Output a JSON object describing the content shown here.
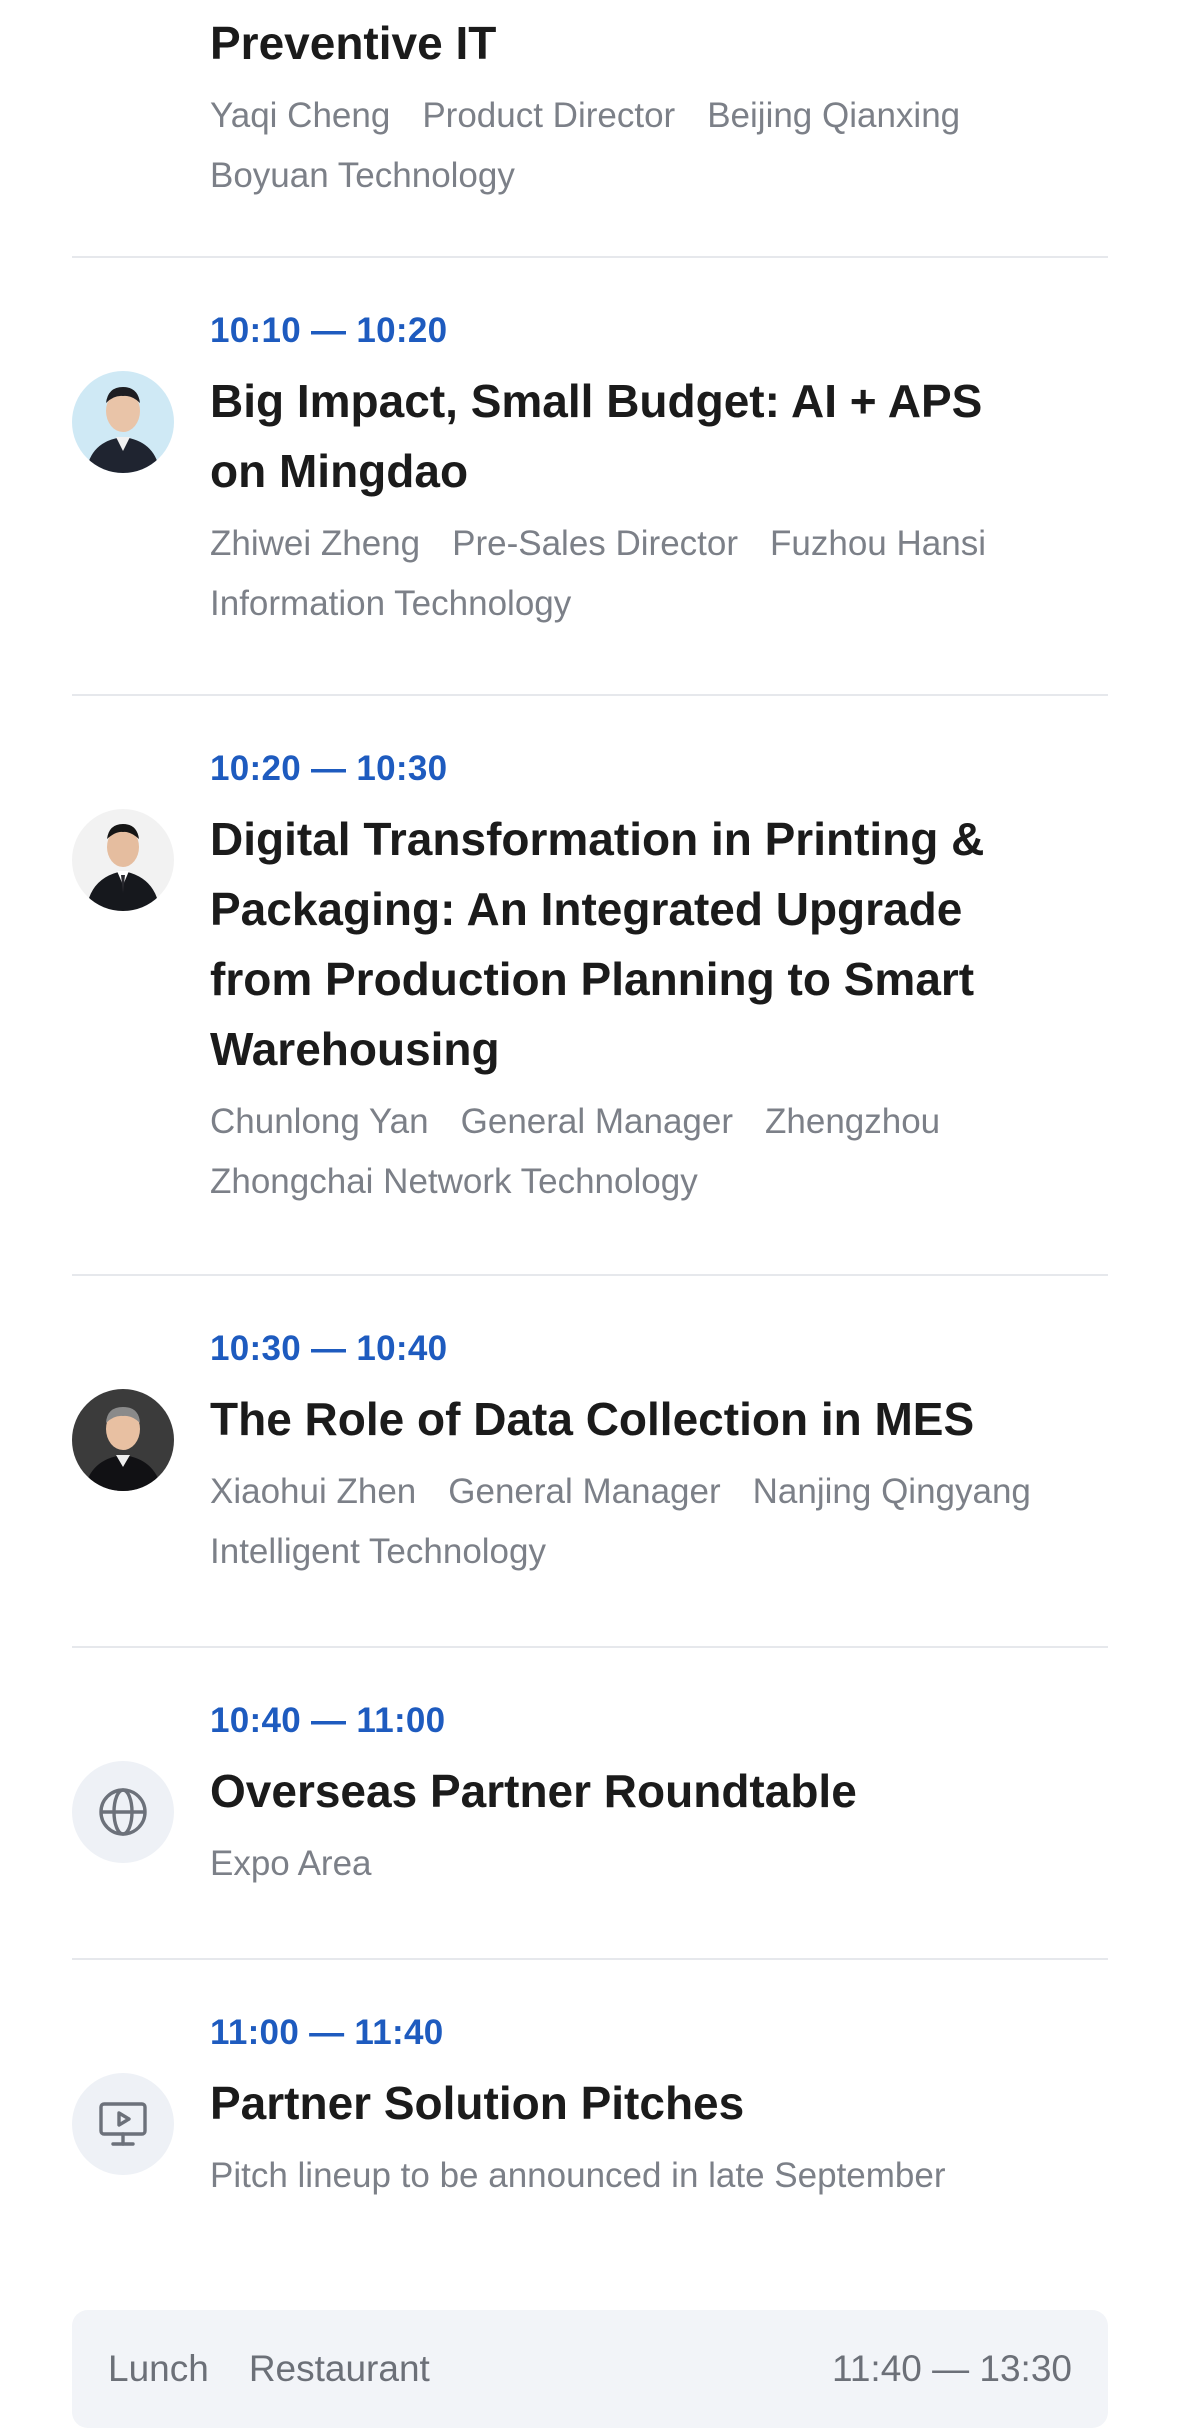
{
  "sessions": [
    {
      "title": "Preventive IT",
      "speaker": "Yaqi Cheng",
      "role": "Product Director",
      "company": "Beijing Qianxing Boyuan Technology"
    },
    {
      "time": "10:10 — 10:20",
      "title": "Big Impact, Small Budget: AI + APS on Mingdao",
      "speaker": "Zhiwei Zheng",
      "role": "Pre-Sales Director",
      "company": "Fuzhou Hansi Information Technology",
      "avatar": "speaker-photo"
    },
    {
      "time": "10:20 — 10:30",
      "title": "Digital Transformation in Printing & Packaging: An Integrated Upgrade from Production Planning to Smart Warehousing",
      "speaker": "Chunlong Yan",
      "role": "General Manager",
      "company": "Zhengzhou Zhongchai Network Technology",
      "avatar": "speaker-photo"
    },
    {
      "time": "10:30 — 10:40",
      "title": "The Role of Data Collection in MES",
      "speaker": "Xiaohui Zhen",
      "role": "General Manager",
      "company": "Nanjing Qingyang Intelligent Technology",
      "avatar": "speaker-photo"
    },
    {
      "time": "10:40 — 11:00",
      "title": "Overseas Partner Roundtable",
      "location": "Expo Area",
      "icon": "globe-icon"
    },
    {
      "time": "11:00 — 11:40",
      "title": "Partner Solution Pitches",
      "note": "Pitch lineup to be announced in late September",
      "icon": "presentation-icon"
    }
  ],
  "lunch": {
    "label": "Lunch",
    "location": "Restaurant",
    "time": "11:40 — 13:30"
  },
  "colors": {
    "accent": "#1e5bbf",
    "title": "#1b1b1b",
    "meta": "#7c8088",
    "divider": "#e6e8ec",
    "icon_bg": "#eef1f6",
    "lunch_bg": "#f2f4f8"
  }
}
